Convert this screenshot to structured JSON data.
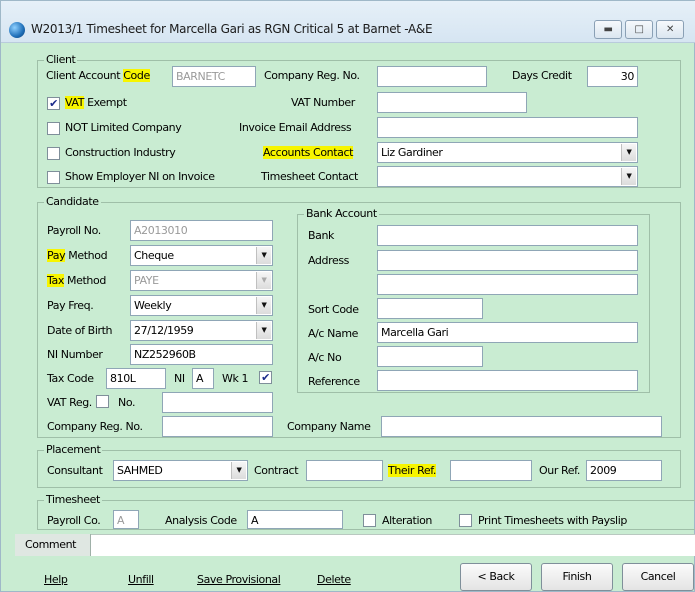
{
  "window": {
    "title": "W2013/1 Timesheet for Marcella Gari as RGN Critical 5 at Barnet -A&E",
    "minimize_icon": "minimize-icon",
    "maximize_icon": "maximize-icon",
    "close_icon": "close-icon"
  },
  "client": {
    "legend": "Client",
    "account_code_label_a": "Client Account ",
    "account_code_label_b": "Code",
    "account_code_value": "BARNETC",
    "company_reg_label": "Company Reg. No.",
    "company_reg_value": "",
    "days_credit_label": "Days Credit",
    "days_credit_value": "30",
    "vat_exempt_label_a": "VAT",
    "vat_exempt_label_b": " Exempt",
    "vat_exempt_checked": "✔",
    "vat_number_label": "VAT Number",
    "vat_number_value": "",
    "not_limited_label": "NOT Limited Company",
    "invoice_email_label": "Invoice Email Address",
    "invoice_email_value": "",
    "construction_label": "Construction Industry",
    "accounts_contact_label": "Accounts Contact",
    "accounts_contact_value": "Liz Gardiner",
    "show_employer_ni_label": "Show Employer NI on Invoice",
    "timesheet_contact_label": "Timesheet Contact",
    "timesheet_contact_value": ""
  },
  "candidate": {
    "legend": "Candidate",
    "payroll_no_label": "Payroll No.",
    "payroll_no_value": "A2013010",
    "pay_method_label_a": "Pay",
    "pay_method_label_b": " Method",
    "pay_method_value": "Cheque",
    "tax_method_label_a": "Tax",
    "tax_method_label_b": " Method",
    "tax_method_value": "PAYE",
    "pay_freq_label": "Pay Freq.",
    "pay_freq_value": "Weekly",
    "dob_label": "Date of Birth",
    "dob_value": "27/12/1959",
    "ni_number_label": "NI Number",
    "ni_number_value": "NZ252960B",
    "tax_code_label": "Tax Code",
    "tax_code_value": "810L",
    "ni_label": "NI",
    "ni_value": "A",
    "wk1_label": "Wk 1",
    "wk1_checked": "✔",
    "vat_reg_label": "VAT Reg.",
    "vat_no_label": "No.",
    "vat_no_value": "",
    "company_reg_label": "Company Reg. No.",
    "company_reg_value": "",
    "company_name_label": "Company Name",
    "company_name_value": ""
  },
  "bank": {
    "legend": "Bank Account",
    "bank_label": "Bank",
    "bank_value": "",
    "address_label": "Address",
    "address_line1": "",
    "address_line2": "",
    "sort_code_label": "Sort Code",
    "sort_code_value": "",
    "ac_name_label": "A/c Name",
    "ac_name_value": "Marcella Gari",
    "ac_no_label": "A/c No",
    "ac_no_value": "",
    "reference_label": "Reference",
    "reference_value": ""
  },
  "placement": {
    "legend": "Placement",
    "consultant_label": "Consultant",
    "consultant_value": "SAHMED",
    "contract_label": "Contract",
    "contract_value": "",
    "their_ref_label": "Their Ref.",
    "their_ref_value": "",
    "our_ref_label": "Our Ref.",
    "our_ref_value": "2009"
  },
  "timesheet": {
    "legend": "Timesheet",
    "payroll_co_label": "Payroll Co.",
    "payroll_co_value": "A",
    "analysis_code_label": "Analysis Code",
    "analysis_code_value": "A",
    "alteration_label": "Alteration",
    "print_timesheets_label": "Print Timesheets with Payslip"
  },
  "comment": {
    "label": "Comment",
    "value": ""
  },
  "footer": {
    "help": "Help",
    "unfill": "Unfill",
    "save_provisional": "Save Provisional",
    "delete": "Delete",
    "back": "< Back",
    "finish": "Finish",
    "cancel": "Cancel"
  },
  "colors": {
    "background": "#c9ecd2",
    "highlight": "#f7f500"
  }
}
